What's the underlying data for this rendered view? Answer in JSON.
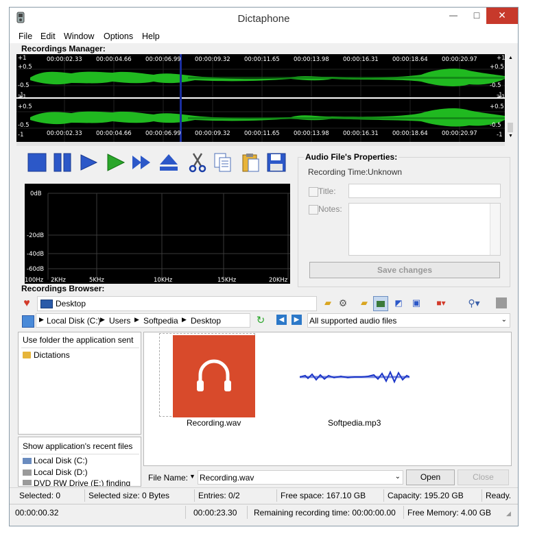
{
  "window": {
    "title": "Dictaphone"
  },
  "titlebar_buttons": {
    "minimize": "—",
    "maximize": "□",
    "close": "✕"
  },
  "menu": [
    "File",
    "Edit",
    "Window",
    "Options",
    "Help"
  ],
  "recordings_manager": {
    "label": "Recordings Manager:",
    "timestamps": [
      "00:00:02.33",
      "00:00:04.66",
      "00:00:06.99",
      "00:00:09.32",
      "00:00:11.65",
      "00:00:13.98",
      "00:00:16.31",
      "00:00:18.64",
      "00:00:20.97"
    ],
    "amp_top_left": [
      "+1",
      "+0.5",
      "-0.5",
      "-1"
    ],
    "amp_bottom_left": [
      "+1",
      "+0.5",
      "-0.5",
      "-1"
    ],
    "amp_top_right": [
      "+1",
      "+0.5",
      "-0.5",
      "-1"
    ],
    "amp_bottom_right": [
      "+1",
      "+0.5",
      "-0.5",
      "-1"
    ],
    "playhead_time": "00:00:06.99"
  },
  "toolbar": {
    "stop": "stop-icon",
    "pause": "pause-icon",
    "play_slow": "play-icon",
    "play": "play-green-icon",
    "fast_forward": "fast-forward-icon",
    "eject": "eject-icon",
    "cut": "scissors-icon",
    "copy": "copy-icon",
    "paste": "paste-icon",
    "save": "floppy-icon"
  },
  "audio_properties": {
    "label": "Audio File's Properties:",
    "recording_time_label": "Recording Time:",
    "recording_time_value": "Unknown",
    "title_label": "Title:",
    "notes_label": "Notes:",
    "save_button": "Save changes"
  },
  "spectrum": {
    "db_labels": [
      "0dB",
      "-20dB",
      "-40dB",
      "-60dB"
    ],
    "freq_labels": [
      "100Hz",
      "2KHz",
      "5KHz",
      "10KHz",
      "15KHz",
      "20KHz"
    ]
  },
  "browser": {
    "label": "Recordings Browser:",
    "location": "Desktop",
    "path": [
      "Local Disk (C:)",
      "Users",
      "Softpedia",
      "Desktop"
    ],
    "filter": "All supported audio files",
    "left_top_header": "Use folder the application sent",
    "left_top_items": [
      "Dictations"
    ],
    "left_bottom_header": "Show application's recent files",
    "left_bottom_items": [
      "Local Disk (C:)",
      "Local Disk (D:)",
      "DVD RW Drive (E:) finding n..."
    ],
    "files": [
      {
        "name": "Recording.wav",
        "selected": true
      },
      {
        "name": "Softpedia.mp3",
        "selected": false
      }
    ],
    "file_name_label": "File Name:",
    "file_name_value": "Recording.wav",
    "open_button": "Open",
    "close_button": "Close"
  },
  "status1": {
    "selected": "Selected: 0",
    "selected_size": "Selected size: 0 Bytes",
    "entries": "Entries: 0/2",
    "free_space": "Free space: 167.10 GB",
    "capacity": "Capacity: 195.20 GB",
    "ready": "Ready."
  },
  "status2": {
    "current_time": "00:00:00.32",
    "total_time": "00:00:23.30",
    "remaining": "Remaining recording time: 00:00:00.00",
    "free_memory": "Free Memory: 4.00 GB"
  },
  "colors": {
    "wave_green": "#22c322",
    "wave_dark_green": "#0b6b12",
    "playhead": "#1a2ea0",
    "accent_blue": "#2c58c8",
    "close_red": "#c7392b",
    "file_tile": "#d84a2b"
  }
}
